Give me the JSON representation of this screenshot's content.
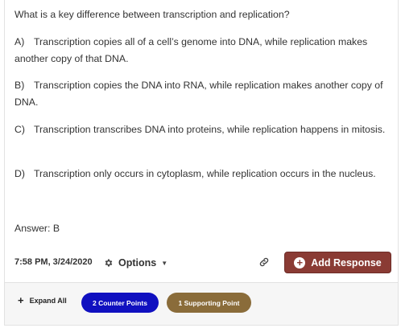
{
  "question": "What is a key difference between transcription and replication?",
  "options": [
    {
      "letter": "A)",
      "text": "Transcription copies all of a cell’s genome into DNA, while replication makes another copy of that DNA."
    },
    {
      "letter": "B)",
      "text": "Transcription copies the DNA into RNA, while replication makes another copy of DNA."
    },
    {
      "letter": "C)",
      "text": "Transcription transcribes DNA into proteins, while replication happens in mitosis."
    },
    {
      "letter": "D)",
      "text": "Transcription only occurs in cytoplasm, while replication occurs in the nucleus."
    }
  ],
  "answer": "Answer: B",
  "meta": {
    "timestamp": "7:58 PM, 3/24/2020",
    "options_label": "Options",
    "add_response_label": "Add Response"
  },
  "footer": {
    "expand_all_label": "Expand All",
    "counter_points_label": "2 Counter Points",
    "supporting_point_label": "1 Supporting Point"
  },
  "colors": {
    "add_button": "#8a3b34",
    "counter_pill": "#1010c0",
    "support_pill": "#8a6c3a"
  },
  "icons": {
    "options": "gear-icon",
    "caret": "caret-down-icon",
    "link": "link-icon",
    "add": "plus-circle-icon",
    "expand": "plus-icon"
  }
}
